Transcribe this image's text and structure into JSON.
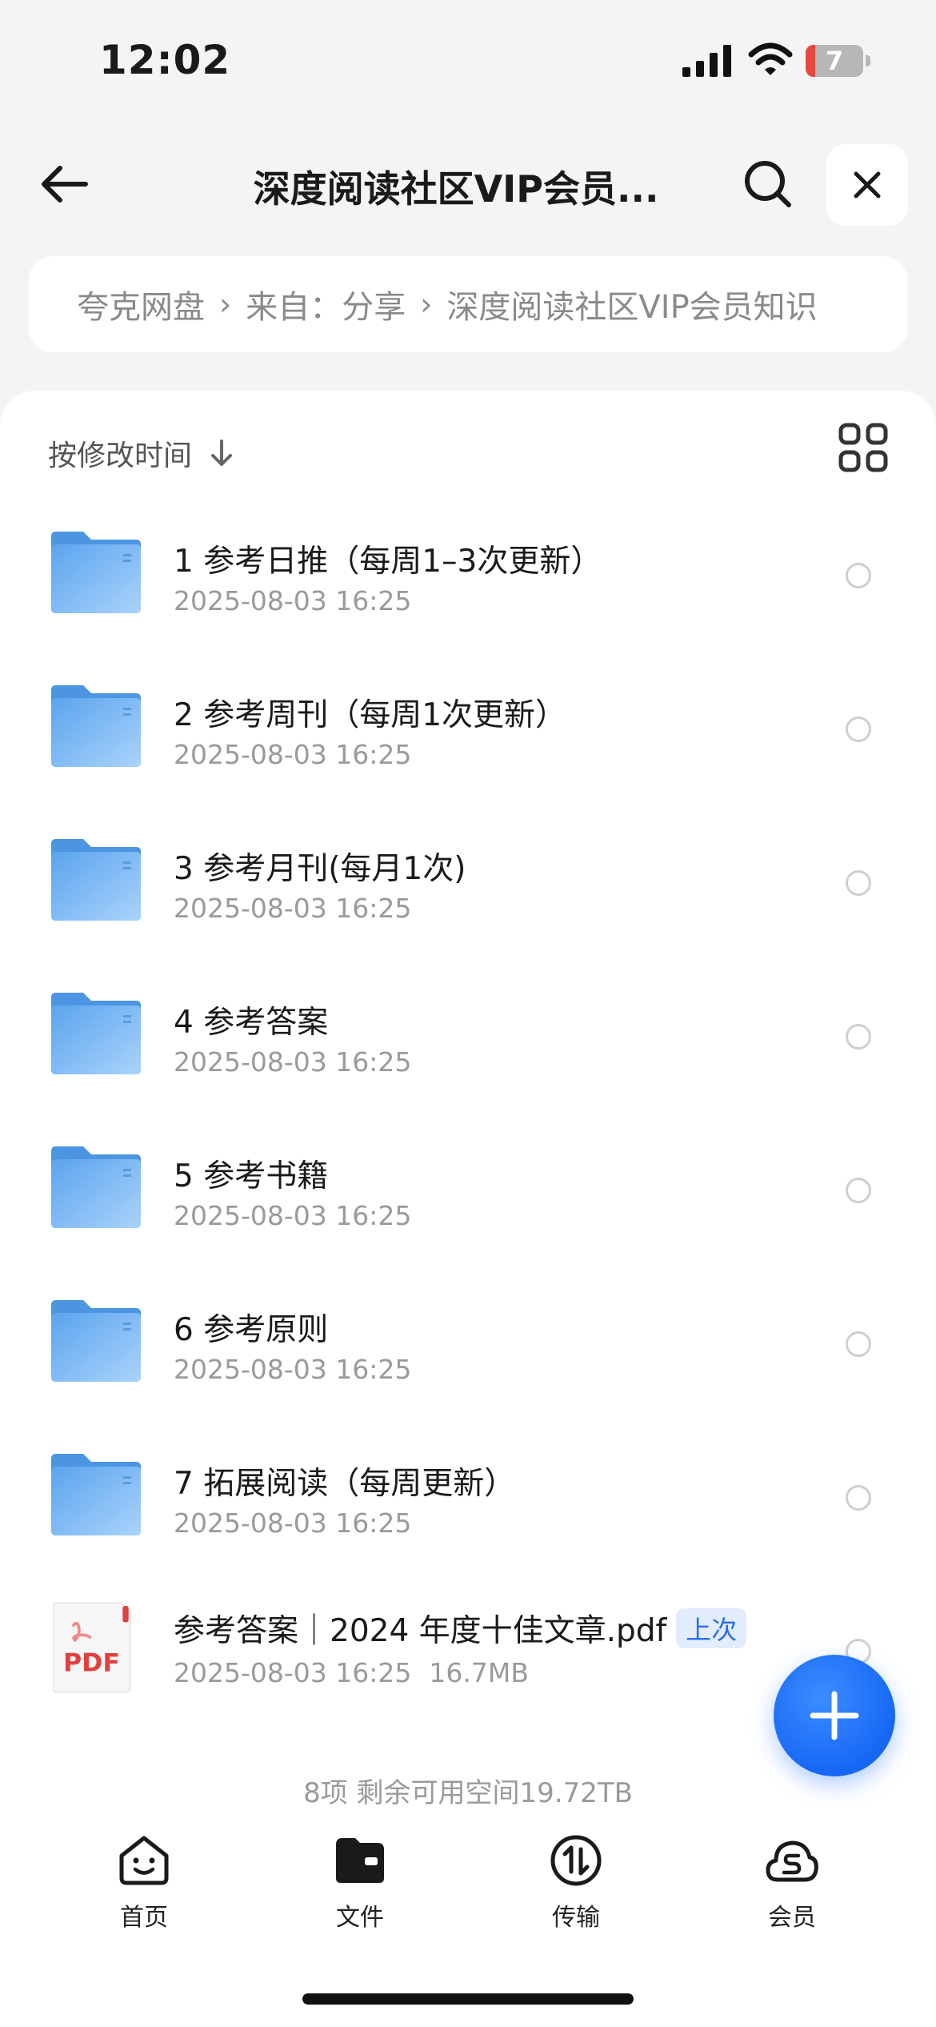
{
  "status_bar": {
    "time": "12:02",
    "battery_level": "7"
  },
  "header": {
    "title": "深度阅读社区VIP会员..."
  },
  "breadcrumb": [
    "夸克网盘",
    "来自：分享",
    "深度阅读社区VIP会员知识"
  ],
  "sort": {
    "label": "按修改时间"
  },
  "files": [
    {
      "name": "1 参考日推（每周1–3次更新）",
      "modified": "2025-08-03 16:25",
      "type": "folder"
    },
    {
      "name": "2 参考周刊（每周1次更新）",
      "modified": "2025-08-03 16:25",
      "type": "folder"
    },
    {
      "name": "3 参考月刊(每月1次)",
      "modified": "2025-08-03 16:25",
      "type": "folder"
    },
    {
      "name": "4 参考答案",
      "modified": "2025-08-03 16:25",
      "type": "folder"
    },
    {
      "name": "5 参考书籍",
      "modified": "2025-08-03 16:25",
      "type": "folder"
    },
    {
      "name": "6 参考原则",
      "modified": "2025-08-03 16:25",
      "type": "folder"
    },
    {
      "name": "7 拓展阅读（每周更新）",
      "modified": "2025-08-03 16:25",
      "type": "folder"
    },
    {
      "name": "参考答案｜2024 年度十佳文章.pdf",
      "modified": "2025-08-03 16:25",
      "size": "16.7MB",
      "type": "pdf",
      "badge": "上次",
      "icon_label": "PDF"
    }
  ],
  "footer": {
    "summary": "8项 剩余可用空间19.72TB"
  },
  "tabs": [
    {
      "label": "首页",
      "icon": "home-face-icon"
    },
    {
      "label": "文件",
      "icon": "folder-icon"
    },
    {
      "label": "传输",
      "icon": "transfer-icon"
    },
    {
      "label": "会员",
      "icon": "vip-cloud-icon"
    }
  ],
  "colors": {
    "accent": "#1767f5",
    "folder": "#5aa6ef",
    "pdf": "#e0403f"
  }
}
